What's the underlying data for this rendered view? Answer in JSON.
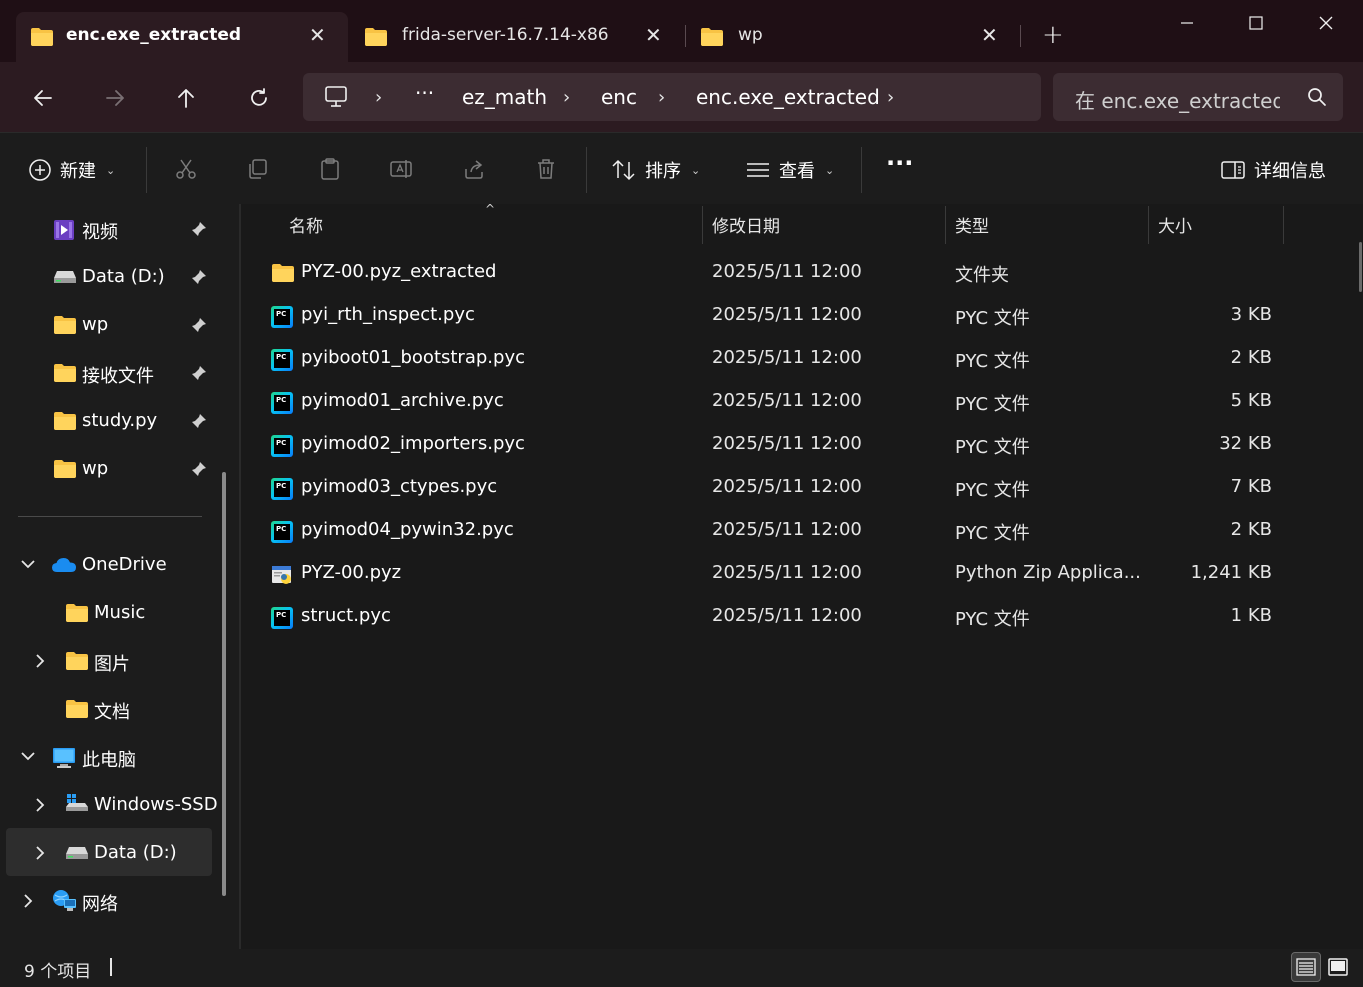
{
  "tabs": [
    {
      "label": "enc.exe_extracted",
      "active": true
    },
    {
      "label": "frida-server-16.7.14-x86",
      "active": false
    },
    {
      "label": "wp",
      "active": false
    }
  ],
  "newtab_symbol": "+",
  "address": {
    "overflow": "···",
    "crumbs": [
      "ez_math",
      "enc",
      "enc.exe_extracted"
    ]
  },
  "search": {
    "placeholder": "在 enc.exe_extracted 中搜索"
  },
  "commands": {
    "new": "新建",
    "sort": "排序",
    "view": "查看",
    "more": "···",
    "details": "详细信息"
  },
  "sidebar": {
    "quick_access": [
      {
        "label": "视频",
        "icon": "video-folder-icon"
      },
      {
        "label": "Data (D:)",
        "icon": "drive-icon"
      },
      {
        "label": "wp",
        "icon": "folder-icon"
      },
      {
        "label": "接收文件",
        "icon": "folder-icon"
      },
      {
        "label": "study.py",
        "icon": "folder-icon"
      },
      {
        "label": "wp",
        "icon": "folder-icon"
      }
    ],
    "tree": [
      {
        "label": "OneDrive",
        "icon": "cloud-icon"
      },
      {
        "label": "Music",
        "icon": "folder-icon"
      },
      {
        "label": "图片",
        "icon": "folder-icon"
      },
      {
        "label": "文档",
        "icon": "folder-icon"
      },
      {
        "label": "此电脑",
        "icon": "computer-icon"
      },
      {
        "label": "Windows-SSD",
        "icon": "drive-icon"
      },
      {
        "label": "Data (D:)",
        "icon": "drive-icon"
      },
      {
        "label": "网络",
        "icon": "network-icon"
      }
    ]
  },
  "columns": {
    "name": "名称",
    "date": "修改日期",
    "type": "类型",
    "size": "大小"
  },
  "files": [
    {
      "name": "PYZ-00.pyz_extracted",
      "date": "2025/5/11 12:00",
      "type": "文件夹",
      "size": "",
      "kind": "folder"
    },
    {
      "name": "pyi_rth_inspect.pyc",
      "date": "2025/5/11 12:00",
      "type": "PYC 文件",
      "size": "3 KB",
      "kind": "pyc"
    },
    {
      "name": "pyiboot01_bootstrap.pyc",
      "date": "2025/5/11 12:00",
      "type": "PYC 文件",
      "size": "2 KB",
      "kind": "pyc"
    },
    {
      "name": "pyimod01_archive.pyc",
      "date": "2025/5/11 12:00",
      "type": "PYC 文件",
      "size": "5 KB",
      "kind": "pyc"
    },
    {
      "name": "pyimod02_importers.pyc",
      "date": "2025/5/11 12:00",
      "type": "PYC 文件",
      "size": "32 KB",
      "kind": "pyc"
    },
    {
      "name": "pyimod03_ctypes.pyc",
      "date": "2025/5/11 12:00",
      "type": "PYC 文件",
      "size": "7 KB",
      "kind": "pyc"
    },
    {
      "name": "pyimod04_pywin32.pyc",
      "date": "2025/5/11 12:00",
      "type": "PYC 文件",
      "size": "2 KB",
      "kind": "pyc"
    },
    {
      "name": "PYZ-00.pyz",
      "date": "2025/5/11 12:00",
      "type": "Python Zip Applica...",
      "size": "1,241 KB",
      "kind": "pyz"
    },
    {
      "name": "struct.pyc",
      "date": "2025/5/11 12:00",
      "type": "PYC 文件",
      "size": "1 KB",
      "kind": "pyc"
    }
  ],
  "status": {
    "count": "9 个项目"
  },
  "colors": {
    "accent_folder": "#f8c344",
    "titlebar": "#1f0f15",
    "navbar": "#2c1b21"
  }
}
